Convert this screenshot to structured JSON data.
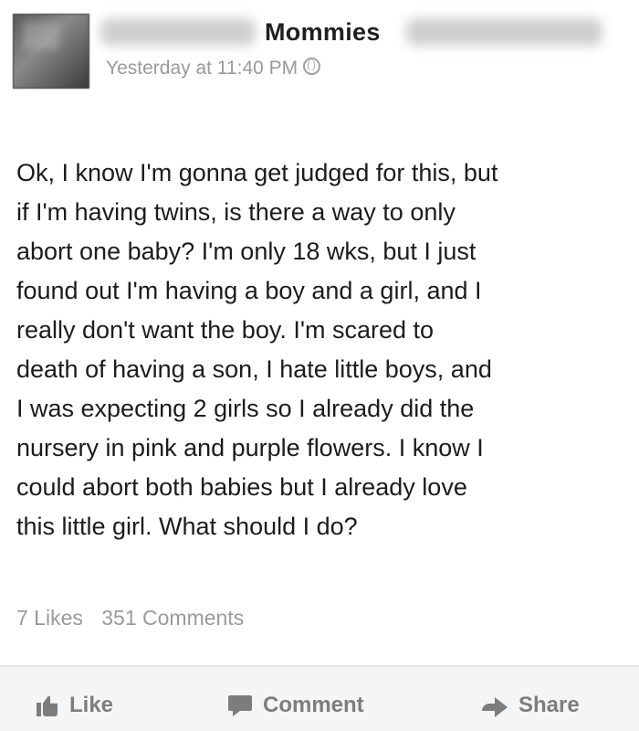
{
  "post": {
    "group_name": "Mommies",
    "timestamp": "Yesterday at 11:40 PM",
    "privacy_icon": "globe-icon",
    "text": "Ok, I know I'm gonna get judged for this, but\nif I'm having twins, is there a way to only\nabort one baby? I'm only 18 wks, but I just\nfound out I'm having a boy and a girl, and I\nreally don't want the boy. I'm scared to\ndeath of having a son, I hate little boys, and\nI was expecting 2 girls so I already did the\nnursery in pink and purple flowers. I know I\ncould abort both babies but I already love\nthis little girl. What should I do?",
    "likes": "7 Likes",
    "comments": "351 Comments"
  },
  "actions": {
    "like_label": "Like",
    "comment_label": "Comment",
    "share_label": "Share"
  }
}
